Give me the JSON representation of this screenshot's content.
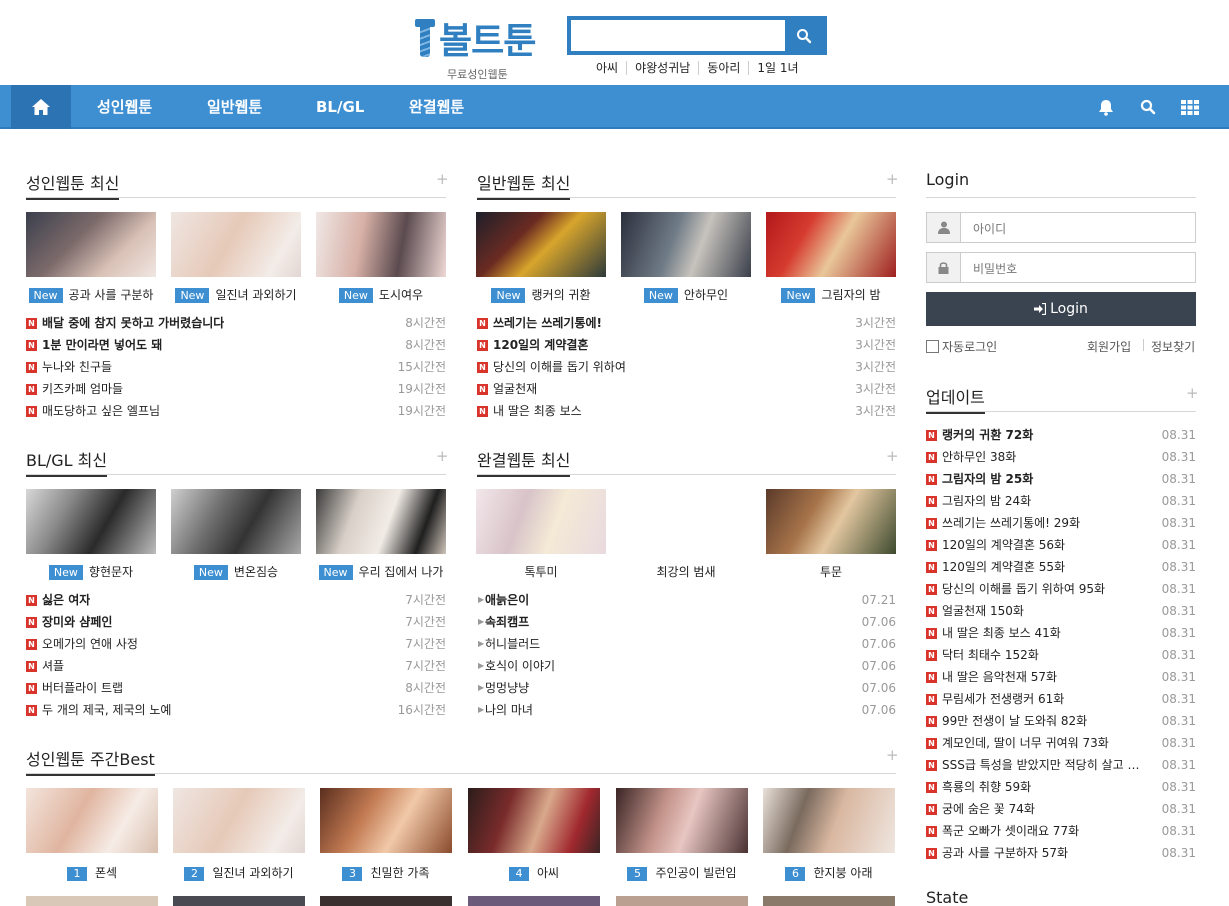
{
  "header": {
    "logo_text": "볼트툰",
    "logo_sub": "무료성인웹툰",
    "search_placeholder": "",
    "popular": [
      "아씨",
      "야왕성귀남",
      "동아리",
      "1일 1녀"
    ]
  },
  "nav": {
    "items": [
      "성인웹툰",
      "일반웹툰",
      "BL/GL",
      "완결웹툰"
    ]
  },
  "colors": {
    "brand": "#3d8fd2",
    "badge": "#3d8fd2",
    "n_icon": "#d9342b",
    "login_btn": "#394450"
  },
  "adult": {
    "title": "성인웹툰 최신",
    "plus": "+",
    "thumbs": [
      {
        "badge": "New",
        "title": "공과 사를 구분하"
      },
      {
        "badge": "New",
        "title": "일진녀 과외하기"
      },
      {
        "badge": "New",
        "title": "도시여우"
      }
    ],
    "list": [
      {
        "title": "배달 중에 참지 못하고 가버렸습니다",
        "time": "8시간전",
        "bold": true
      },
      {
        "title": "1분 만이라면 넣어도 돼",
        "time": "8시간전",
        "bold": true
      },
      {
        "title": "누나와 친구들",
        "time": "15시간전",
        "bold": false
      },
      {
        "title": "키즈카페 엄마들",
        "time": "19시간전",
        "bold": false
      },
      {
        "title": "매도당하고 싶은 엘프님",
        "time": "19시간전",
        "bold": false
      }
    ]
  },
  "general": {
    "title": "일반웹툰 최신",
    "plus": "+",
    "thumbs": [
      {
        "badge": "New",
        "title": "랭커의 귀환"
      },
      {
        "badge": "New",
        "title": "안하무인"
      },
      {
        "badge": "New",
        "title": "그림자의 밤"
      }
    ],
    "list": [
      {
        "title": "쓰레기는 쓰레기통에!",
        "time": "3시간전",
        "bold": true
      },
      {
        "title": "120일의 계약결혼",
        "time": "3시간전",
        "bold": true
      },
      {
        "title": "당신의 이해를 돕기 위하여",
        "time": "3시간전",
        "bold": false
      },
      {
        "title": "얼굴천재",
        "time": "3시간전",
        "bold": false
      },
      {
        "title": "내 딸은 최종 보스",
        "time": "3시간전",
        "bold": false
      }
    ]
  },
  "blgl": {
    "title": "BL/GL 최신",
    "plus": "+",
    "thumbs": [
      {
        "badge": "New",
        "title": "향현문자"
      },
      {
        "badge": "New",
        "title": "변온짐승"
      },
      {
        "badge": "New",
        "title": "우리 집에서 나가"
      }
    ],
    "list": [
      {
        "title": "싫은 여자",
        "time": "7시간전",
        "bold": true
      },
      {
        "title": "장미와 샴페인",
        "time": "7시간전",
        "bold": true
      },
      {
        "title": "오메가의 연애 사정",
        "time": "7시간전",
        "bold": false
      },
      {
        "title": "셔플",
        "time": "7시간전",
        "bold": false
      },
      {
        "title": "버터플라이 트랩",
        "time": "8시간전",
        "bold": false
      },
      {
        "title": "두 개의 제국, 제국의 노예",
        "time": "16시간전",
        "bold": false
      }
    ]
  },
  "completed": {
    "title": "완결웹툰 최신",
    "plus": "+",
    "thumbs": [
      {
        "title": "톡투미"
      },
      {
        "title": "최강의 범새"
      },
      {
        "title": "투문"
      }
    ],
    "list": [
      {
        "title": "애늙은이",
        "time": "07.21",
        "bold": true
      },
      {
        "title": "속죄캠프",
        "time": "07.06",
        "bold": true
      },
      {
        "title": "허니블러드",
        "time": "07.06",
        "bold": false
      },
      {
        "title": "호식이 이야기",
        "time": "07.06",
        "bold": false
      },
      {
        "title": "멍멍냥냥",
        "time": "07.06",
        "bold": false
      },
      {
        "title": "나의 마녀",
        "time": "07.06",
        "bold": false
      }
    ]
  },
  "weekly": {
    "title": "성인웹툰 주간Best",
    "plus": "+",
    "items": [
      {
        "rank": "1",
        "title": "폰섹"
      },
      {
        "rank": "2",
        "title": "일진녀 과외하기"
      },
      {
        "rank": "3",
        "title": "친밀한 가족"
      },
      {
        "rank": "4",
        "title": "아씨"
      },
      {
        "rank": "5",
        "title": "주인공이 빌런임"
      },
      {
        "rank": "6",
        "title": "한지붕 아래"
      }
    ]
  },
  "login": {
    "title": "Login",
    "id_placeholder": "아이디",
    "pw_placeholder": "비밀번호",
    "button": "Login",
    "auto_login": "자동로그인",
    "join": "회원가입",
    "find": "정보찾기"
  },
  "update": {
    "title": "업데이트",
    "plus": "+",
    "list": [
      {
        "title": "랭커의 귀환 72화",
        "time": "08.31",
        "bold": true
      },
      {
        "title": "안하무인 38화",
        "time": "08.31",
        "bold": false
      },
      {
        "title": "그림자의 밤 25화",
        "time": "08.31",
        "bold": true
      },
      {
        "title": "그림자의 밤 24화",
        "time": "08.31",
        "bold": false
      },
      {
        "title": "쓰레기는 쓰레기통에! 29화",
        "time": "08.31",
        "bold": false
      },
      {
        "title": "120일의 계약결혼 56화",
        "time": "08.31",
        "bold": false
      },
      {
        "title": "120일의 계약결혼 55화",
        "time": "08.31",
        "bold": false
      },
      {
        "title": "당신의 이해를 돕기 위하여 95화",
        "time": "08.31",
        "bold": false
      },
      {
        "title": "얼굴천재 150화",
        "time": "08.31",
        "bold": false
      },
      {
        "title": "내 딸은 최종 보스 41화",
        "time": "08.31",
        "bold": false
      },
      {
        "title": "닥터 최태수 152화",
        "time": "08.31",
        "bold": false
      },
      {
        "title": "내 딸은 음악천재 57화",
        "time": "08.31",
        "bold": false
      },
      {
        "title": "무림세가 전생랭커 61화",
        "time": "08.31",
        "bold": false
      },
      {
        "title": "99만 전생이 날 도와줘 82화",
        "time": "08.31",
        "bold": false
      },
      {
        "title": "계모인데, 딸이 너무 귀여워 73화",
        "time": "08.31",
        "bold": false
      },
      {
        "title": "SSS급 특성을 받았지만 적당히 살고 싶어 26화",
        "time": "08.31",
        "bold": false
      },
      {
        "title": "흑룡의 취향 59화",
        "time": "08.31",
        "bold": false
      },
      {
        "title": "궁에 숨은 꽃 74화",
        "time": "08.31",
        "bold": false
      },
      {
        "title": "폭군 오빠가 셋이래요 77화",
        "time": "08.31",
        "bold": false
      },
      {
        "title": "공과 사를 구분하자 57화",
        "time": "08.31",
        "bold": false
      }
    ]
  },
  "state": {
    "title": "State"
  },
  "icons": {
    "home": "home-icon",
    "search": "search-icon",
    "bell": "bell-icon",
    "grid": "grid-icon",
    "user": "user-icon",
    "lock": "lock-icon",
    "signin": "sign-in-icon",
    "new": "new-icon"
  }
}
